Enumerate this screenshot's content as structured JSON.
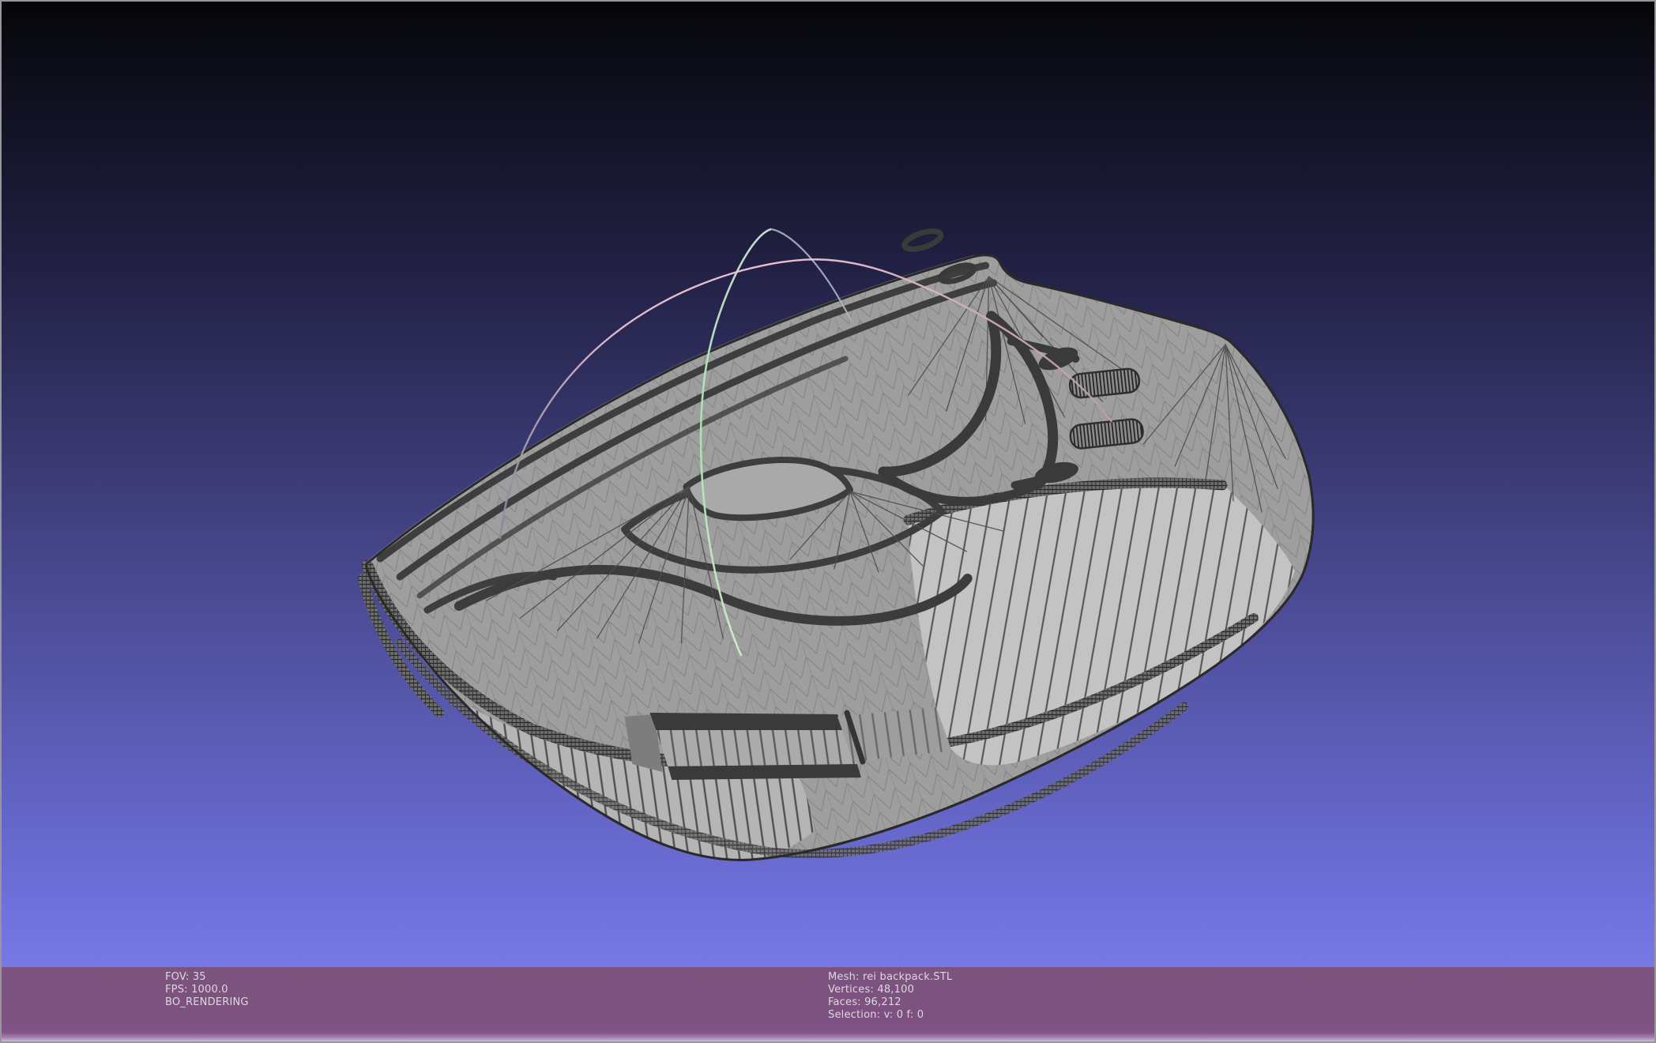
{
  "viewport": {
    "background_top": "#060609",
    "background_upper": "#222145",
    "background_mid": "#4a4a93",
    "background_lower": "#6f71dd",
    "background_bottom": "#7678e4",
    "trackball_green_arc": "#aae6ae",
    "trackball_pink_arc": "#f2c8d8"
  },
  "mesh_render": {
    "surface_fill": "#9e9e9e",
    "side_band_fill": "#b5b5b5",
    "right_band_fill": "#c3c3c3",
    "wire_color": "#3c3c3c",
    "outline_color": "#2a2a2a"
  },
  "status_bar": {
    "background": "#7d5180",
    "text_color": "#ddd8e0",
    "left": {
      "fov": "FOV: 35",
      "fps": "FPS: 1000.0",
      "mode": "BO_RENDERING"
    },
    "center": {
      "mesh": "Mesh: rei backpack.STL",
      "vertices": "Vertices: 48,100",
      "faces": "Faces: 96,212",
      "selection": "Selection: v: 0 f: 0"
    }
  }
}
